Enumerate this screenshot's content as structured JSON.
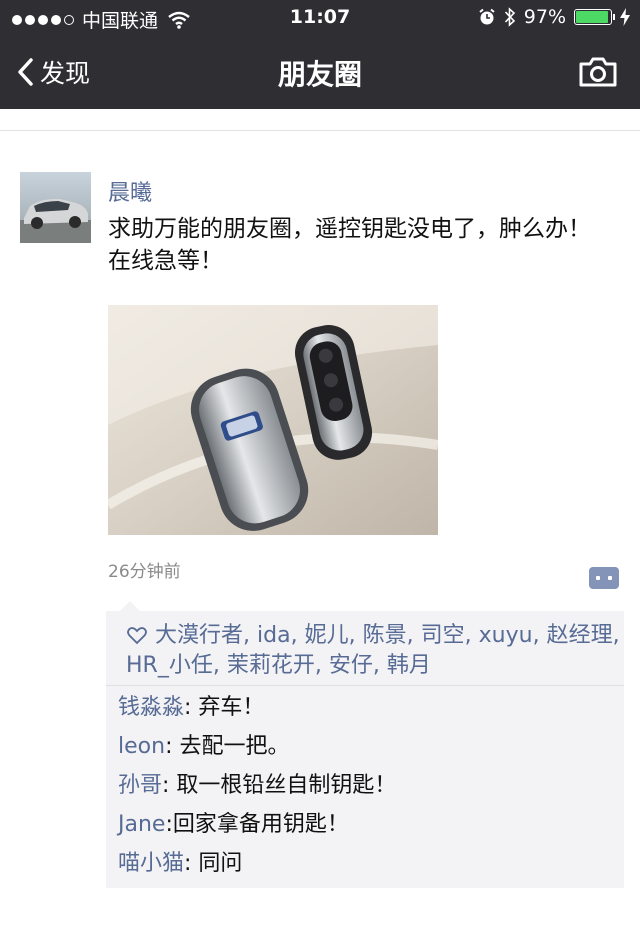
{
  "status_bar": {
    "carrier": "中国联通",
    "time": "11:07",
    "battery": "97%",
    "battery_level": 0.97,
    "signal_dots_filled": 4,
    "signal_dots_total": 5
  },
  "nav": {
    "back_label": "发现",
    "title": "朋友圈"
  },
  "post": {
    "author": "晨曦",
    "text": "求助万能的朋友圈，遥控钥匙没电了，肿么办！在线急等！",
    "time_ago": "26分钟前"
  },
  "likes": {
    "users": [
      "大漠行者",
      "ida",
      "妮儿",
      "陈景",
      "司空",
      "xuyu",
      "赵经理",
      "HR_小任",
      "茉莉花开",
      "安仔",
      "韩月"
    ],
    "separator": ", "
  },
  "comments": [
    {
      "author": "钱淼淼",
      "sep": ": ",
      "text": "弃车！"
    },
    {
      "author": "leon",
      "sep": ": ",
      "text": "去配一把。"
    },
    {
      "author": "孙哥",
      "sep": ": ",
      "text": "取一根铅丝自制钥匙！"
    },
    {
      "author": "Jane",
      "sep": ":",
      "text": "回家拿备用钥匙！"
    },
    {
      "author": "喵小猫",
      "sep": ": ",
      "text": "同问"
    }
  ],
  "colors": {
    "nav_bg": "#2e2e33",
    "link_blue": "#576b95",
    "battery_green": "#4cd964",
    "comment_panel": "#f3f3f5"
  }
}
